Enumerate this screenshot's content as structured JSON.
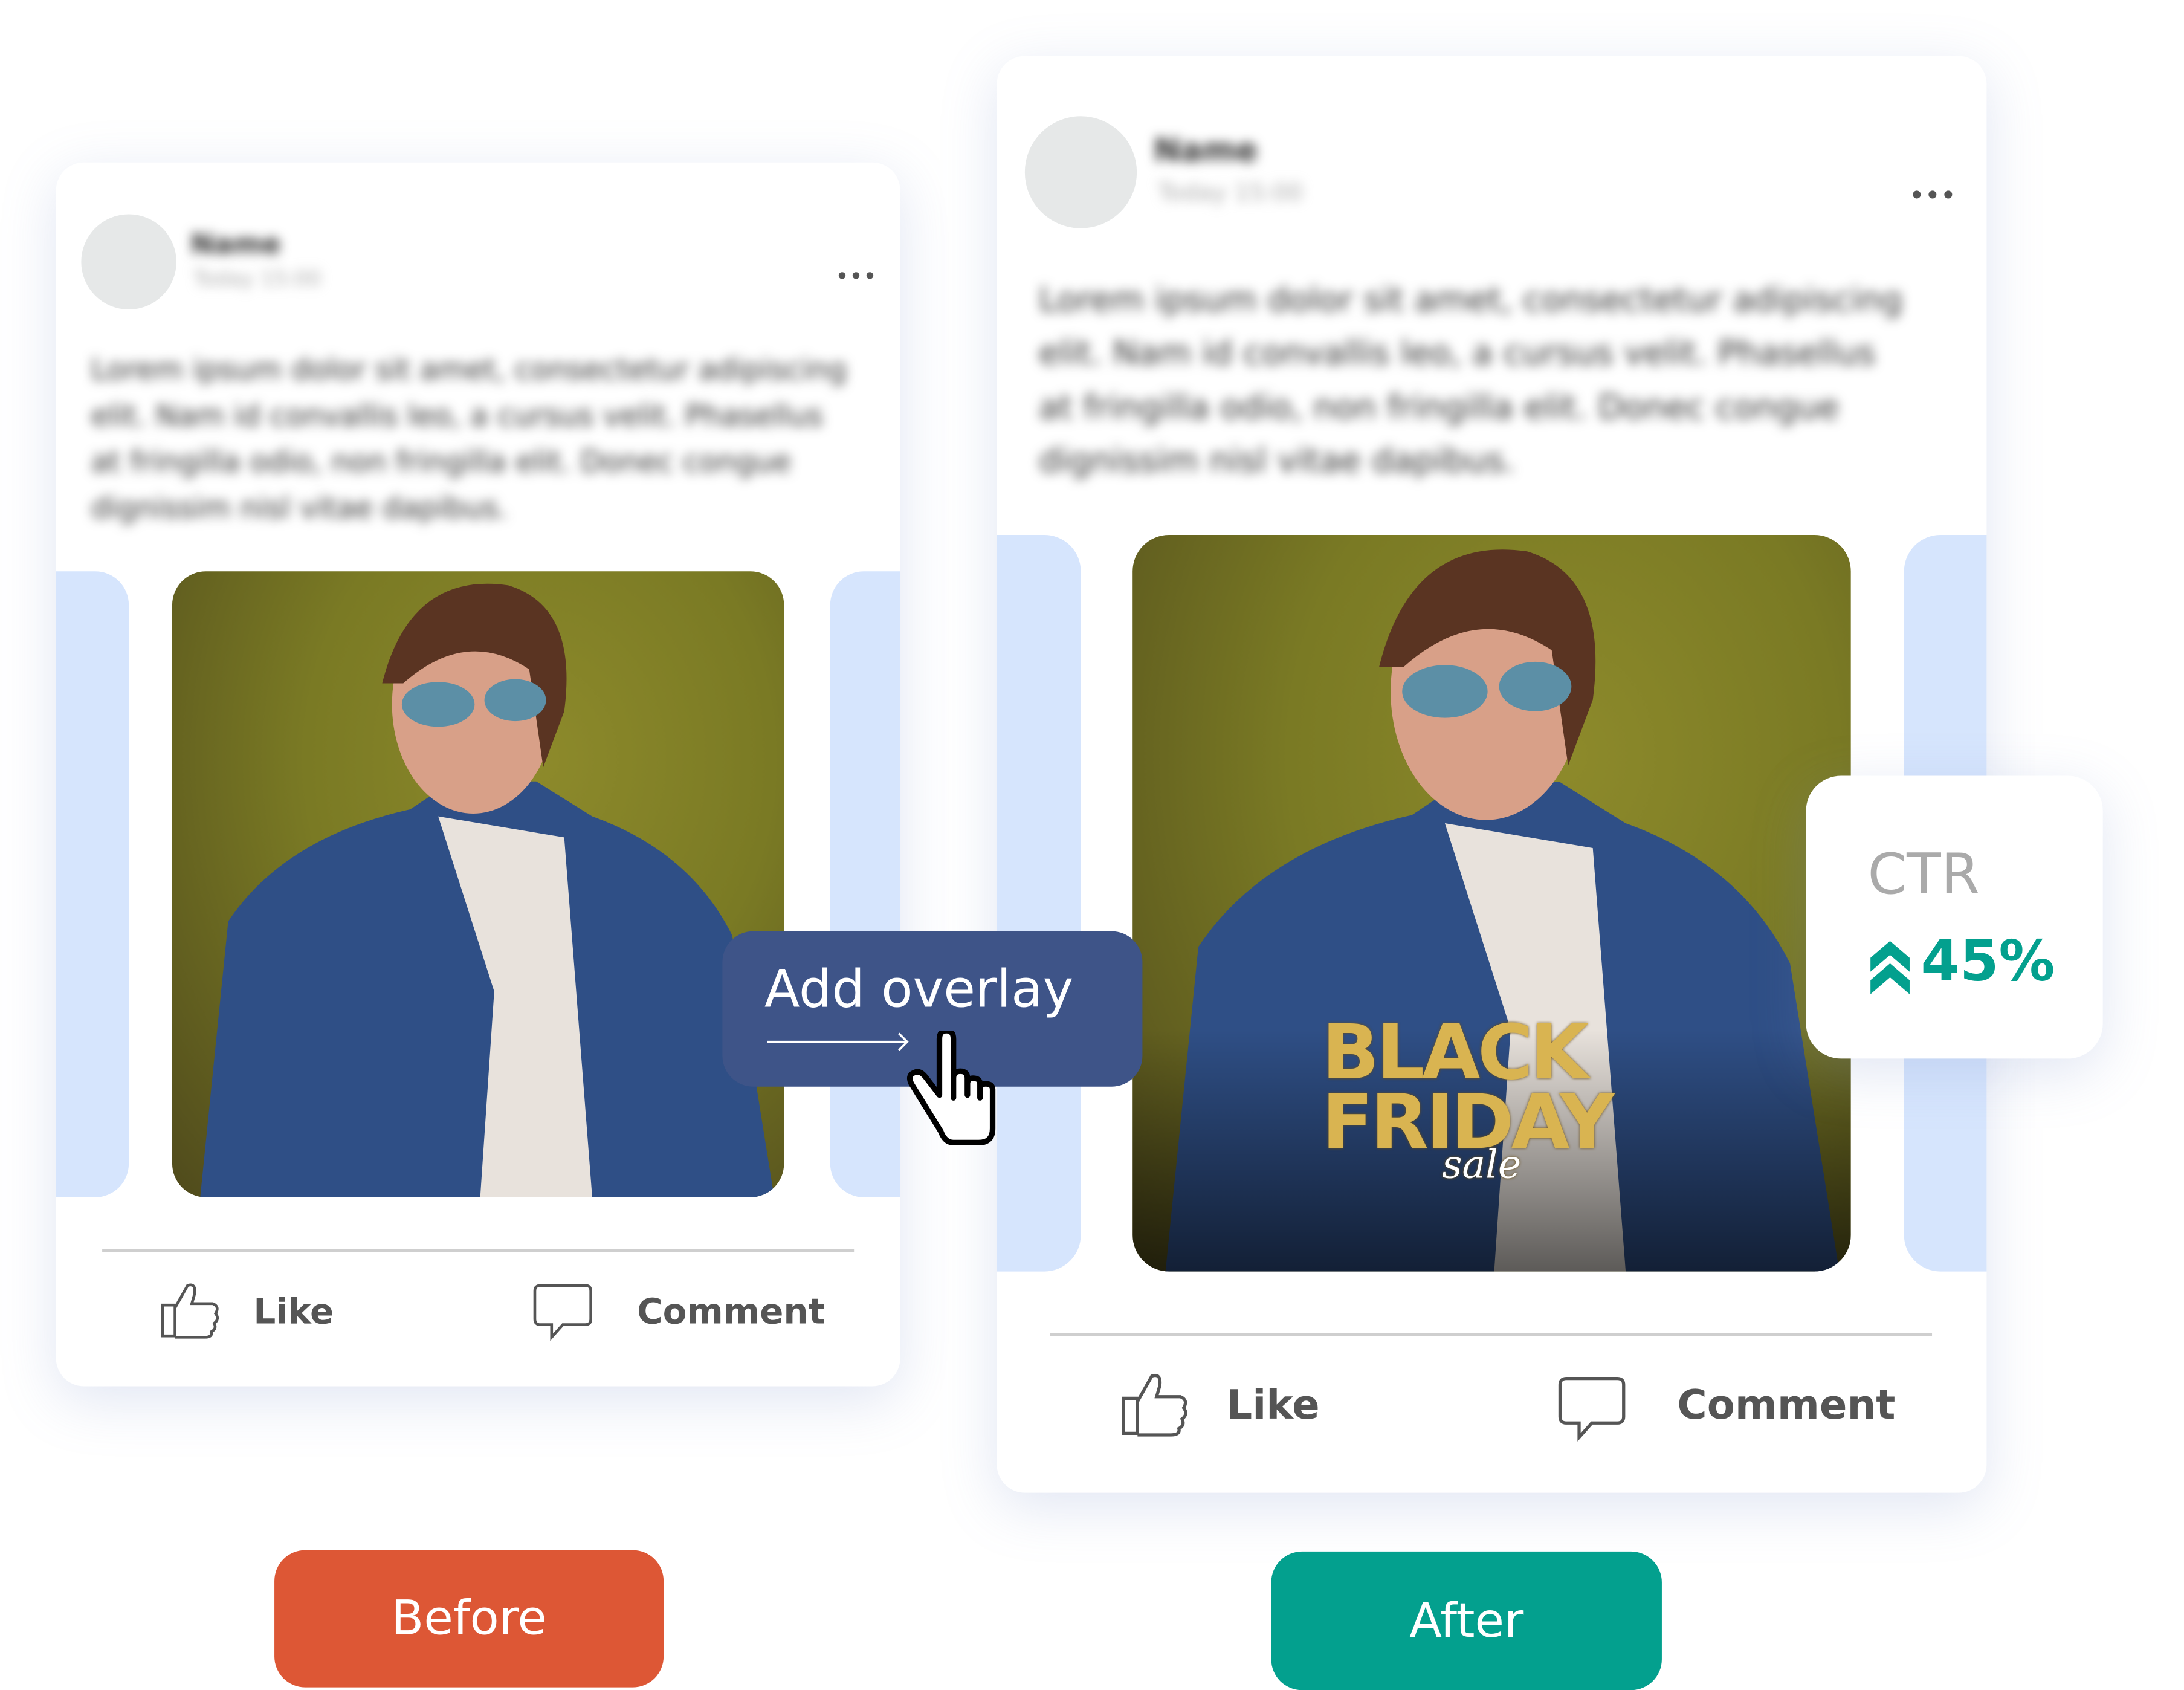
{
  "before_card": {
    "author_name": "Name",
    "timestamp": "Today 15:00",
    "post_text": [
      "Lorem ipsum dolor sit amet, consectetur adipiscing",
      "elit. Nam id convallis leo, a cursus velit. Phasellus",
      "at fringilla odio, non fringilla elit. Donec congue",
      "dignissim nisl vitae dapibus."
    ],
    "more_label": "•••",
    "like_label": "Like",
    "comment_label": "Comment"
  },
  "after_card": {
    "author_name": "Name",
    "timestamp": "Today 15:00",
    "post_text": [
      "Lorem ipsum dolor sit amet, consectetur adipiscing",
      "elit. Nam id convallis leo, a cursus velit. Phasellus",
      "at fringilla odio, non fringilla elit. Donec congue",
      "dignissim nisl vitae dapibus."
    ],
    "more_label": "•••",
    "like_label": "Like",
    "comment_label": "Comment",
    "overlay_line1": "BLACK",
    "overlay_line2": "FRIDAY",
    "overlay_line3": "sale"
  },
  "add_overlay": {
    "label": "Add overlay"
  },
  "ctr": {
    "label": "CTR",
    "value": "45%",
    "trend": "up",
    "color": "#03a08e"
  },
  "labels": {
    "before": "Before",
    "after": "After"
  },
  "colors": {
    "before": "#dd5735",
    "after": "#03a08e",
    "overlay_button": "#3e5488",
    "side_bars": "#d6e5fd"
  }
}
